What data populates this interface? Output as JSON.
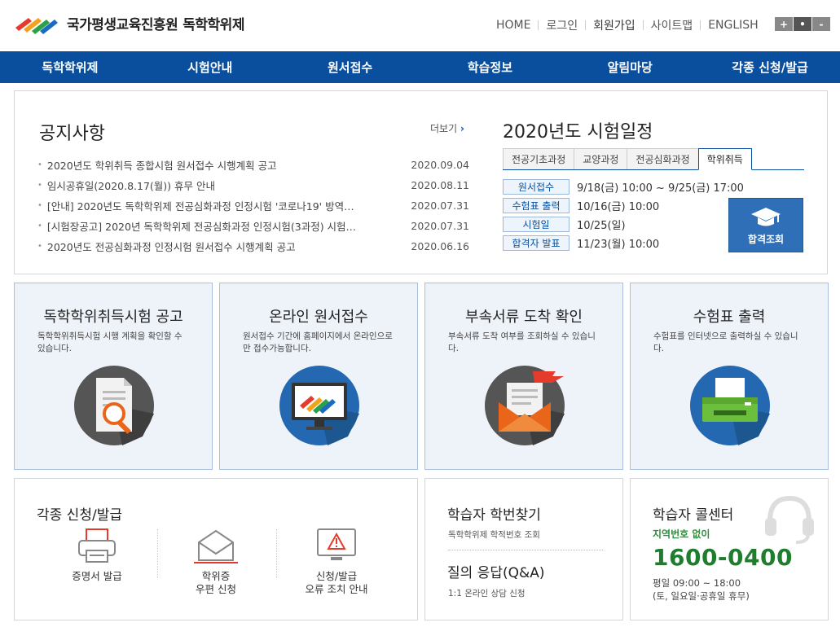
{
  "header": {
    "org": "국가평생교육진흥원",
    "service": "독학학위제",
    "topnav": [
      "HOME",
      "로그인",
      "회원가입",
      "사이트맵",
      "ENGLISH"
    ],
    "font_controls": [
      "+",
      "•",
      "-"
    ]
  },
  "mainnav": [
    "독학학위제",
    "시험안내",
    "원서접수",
    "학습정보",
    "알림마당",
    "각종 신청/발급"
  ],
  "notice": {
    "title": "공지사항",
    "more": "더보기",
    "more_icon": "chevron-right-icon",
    "items": [
      {
        "title": "2020년도 학위취득 종합시험 원서접수 시행계획 공고",
        "date": "2020.09.04"
      },
      {
        "title": "임시공휴일(2020.8.17(월)) 휴무 안내",
        "date": "2020.08.11"
      },
      {
        "title": "[안내] 2020년도 독학학위제 전공심화과정 인정시험 '코로나19' 방역…",
        "date": "2020.07.31"
      },
      {
        "title": "[시험장공고] 2020년 독학학위제 전공심화과정 인정시험(3과정) 시험…",
        "date": "2020.07.31"
      },
      {
        "title": "2020년도 전공심화과정 인정시험 원서접수 시행계획 공고",
        "date": "2020.06.16"
      }
    ]
  },
  "schedule": {
    "title": "2020년도 시험일정",
    "tabs": [
      "전공기초과정",
      "교양과정",
      "전공심화과정",
      "학위취득"
    ],
    "active_tab": "학위취득",
    "rows": [
      {
        "label": "원서접수",
        "value": "9/18(금) 10:00 ~ 9/25(금) 17:00"
      },
      {
        "label": "수험표 출력",
        "value": "10/16(금) 10:00"
      },
      {
        "label": "시험일",
        "value": "10/25(일)"
      },
      {
        "label": "합격자 발표",
        "value": "11/23(월) 10:00"
      }
    ],
    "pass_button": "합격조회"
  },
  "cards": [
    {
      "title": "독학학위취득시험 공고",
      "desc": "독학학위취득시험 시행 계획을 확인할 수 있습니다.",
      "icon": "document-search-icon"
    },
    {
      "title": "온라인 원서접수",
      "desc": "원서접수 기간에 홈페이지에서 온라인으로만 접수가능합니다.",
      "icon": "monitor-icon"
    },
    {
      "title": "부속서류 도착 확인",
      "desc": "부속서류 도착 여부를 조회하실 수 있습니다.",
      "icon": "envelope-icon"
    },
    {
      "title": "수험표 출력",
      "desc": "수험표를 인터넷으로 출력하실 수 있습니다.",
      "icon": "printer-icon"
    }
  ],
  "apply": {
    "title": "각종 신청/발급",
    "items": [
      {
        "label": "증명서 발급",
        "icon": "printer-icon"
      },
      {
        "label": "학위증\n우편 신청",
        "icon": "mail-icon"
      },
      {
        "label": "신청/발급\n오류 조치 안내",
        "icon": "warning-monitor-icon"
      }
    ]
  },
  "student": {
    "find_title": "학습자 학번찾기",
    "find_sub": "독학학위제 학적번호 조회",
    "qa_title": "질의 응답(Q&A)",
    "qa_sub": "1:1 온라인 상담 신청"
  },
  "callcenter": {
    "title": "학습자 콜센터",
    "area": "지역번호 없이",
    "phone": "1600-0400",
    "hours1": "평일 09:00 ~ 18:00",
    "hours2": "(토, 일요일·공휴일 휴무)",
    "icon": "headset-icon"
  }
}
